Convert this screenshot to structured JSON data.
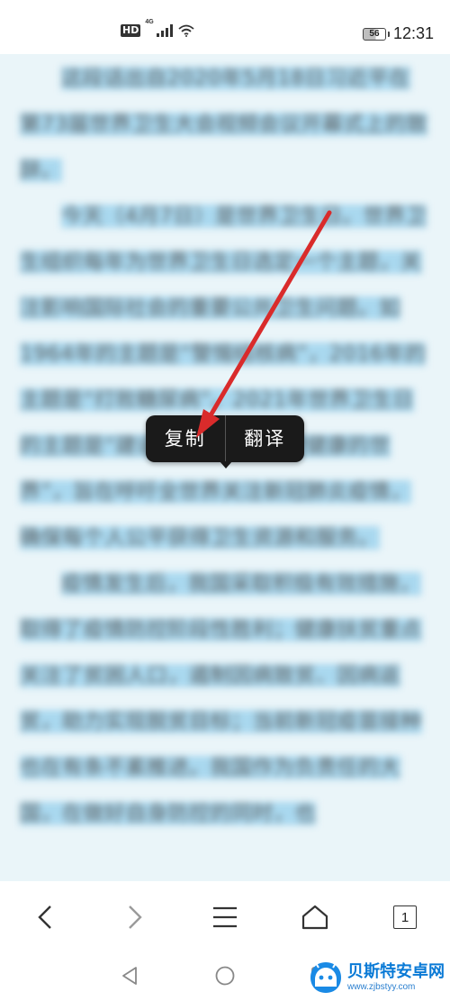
{
  "status_bar": {
    "network_hd": "HD",
    "network_gen": "4G",
    "battery_level": "56",
    "time": "12:31",
    "icons": [
      "hd-icon",
      "signal-icon",
      "wifi-icon",
      "battery-icon"
    ]
  },
  "article": {
    "paragraphs": [
      "这段话出自2020年5月18日习近平在第73届世界卫生大会视频会议开幕式上的致辞。",
      "今天（4月7日）是世界卫生日。世界卫生组织每年为世界卫生日选定一个主题，关注影响国际社会的重要公共卫生问题。如1964年的主题是“警惕结核病”，2016年的主题是“打败糖尿病”。2021年世界卫生日的主题是“建设一个更公平、更健康的世界”，旨在呼吁全世界关注新冠肺炎疫情，确保每个人公平获得卫生资源和服务。",
      "疫情发生后，我国采取积极有效措施，取得了疫情防控阶段性胜利；健康扶贫重点关注了贫困人口，遏制因病致贫、因病返贫，助力实现脱贫目标；当前新冠疫苗接种也在有条不紊推进。我国作为负责任的大国，在做好自身防控的同时，也"
    ],
    "selection_color": "#a9d8ef"
  },
  "popup": {
    "copy_label": "复制",
    "translate_label": "翻译"
  },
  "annotation": {
    "arrow_color": "#d92b2b"
  },
  "browser_toolbar": {
    "icons": [
      "back-icon",
      "forward-icon",
      "menu-icon",
      "home-icon",
      "tabs-icon"
    ],
    "tab_count": "1"
  },
  "system_nav": {
    "icons": [
      "system-back-icon",
      "system-home-icon",
      "system-recents-icon"
    ]
  },
  "watermark": {
    "title": "贝斯特安卓网",
    "url": "www.zjbstyy.com"
  }
}
